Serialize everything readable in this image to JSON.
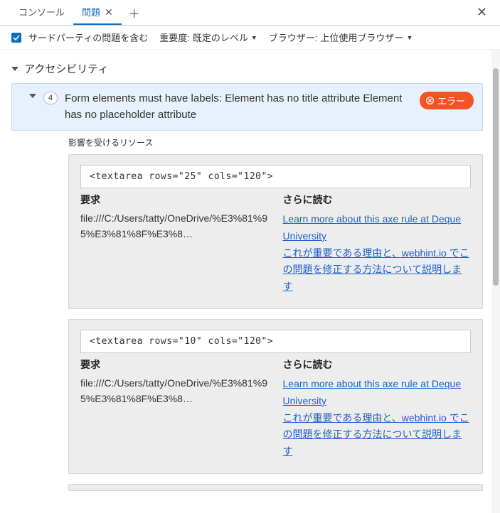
{
  "tabs": {
    "console": "コンソール",
    "issues": "問題"
  },
  "toolbar": {
    "include_third_party": "サードパーティの問題を含む",
    "severity_label": "重要度:",
    "severity_value": "既定のレベル",
    "browser_label": "ブラウザー:",
    "browser_value": "上位使用ブラウザー"
  },
  "category": {
    "title": "アクセシビリティ"
  },
  "issue": {
    "count": "4",
    "title": "Form elements must have labels: Element has no title attribute Element has no placeholder attribute",
    "error_badge": "エラー"
  },
  "labels": {
    "affected_resources": "影響を受けるリソース",
    "request": "要求",
    "read_more": "さらに読む"
  },
  "resources": [
    {
      "code": "<textarea rows=\"25\" cols=\"120\">",
      "request": "file:///C:/Users/tatty/OneDrive/%E3%81%95%E3%81%8F%E3%8…",
      "links": [
        "Learn more about this axe rule at Deque University",
        "これが重要である理由と、webhint.io でこの問題を修正する方法について説明します"
      ]
    },
    {
      "code": "<textarea rows=\"10\" cols=\"120\">",
      "request": "file:///C:/Users/tatty/OneDrive/%E3%81%95%E3%81%8F%E3%8…",
      "links": [
        "Learn more about this axe rule at Deque University",
        "これが重要である理由と、webhint.io でこの問題を修正する方法について説明します"
      ]
    }
  ]
}
